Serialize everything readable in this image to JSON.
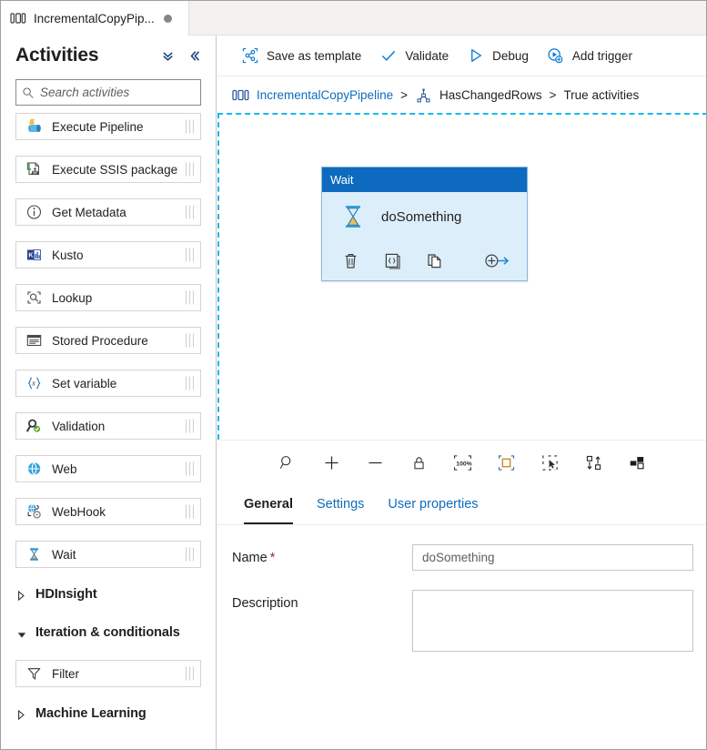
{
  "tab": {
    "icon": "pipeline-icon",
    "title": "IncrementalCopyPip...",
    "dirty_dot": "unsaved-changes-dot"
  },
  "sidebar": {
    "title": "Activities",
    "collapse_all_icon": "chevron-double-down-icon",
    "collapse_panel_icon": "chevron-double-left-icon",
    "search": {
      "placeholder": "Search activities",
      "value": "",
      "icon": "search-icon"
    },
    "items": [
      {
        "type": "activity",
        "label": "Execute Pipeline",
        "icon": "execute-pipeline-icon"
      },
      {
        "type": "activity",
        "label": "Execute SSIS package",
        "icon": "execute-ssis-package-icon"
      },
      {
        "type": "activity",
        "label": "Get Metadata",
        "icon": "get-metadata-icon"
      },
      {
        "type": "activity",
        "label": "Kusto",
        "icon": "kusto-icon"
      },
      {
        "type": "activity",
        "label": "Lookup",
        "icon": "lookup-icon"
      },
      {
        "type": "activity",
        "label": "Stored Procedure",
        "icon": "stored-procedure-icon"
      },
      {
        "type": "activity",
        "label": "Set variable",
        "icon": "set-variable-icon"
      },
      {
        "type": "activity",
        "label": "Validation",
        "icon": "validation-icon"
      },
      {
        "type": "activity",
        "label": "Web",
        "icon": "web-icon"
      },
      {
        "type": "activity",
        "label": "WebHook",
        "icon": "webhook-icon"
      },
      {
        "type": "activity",
        "label": "Wait",
        "icon": "wait-hourglass-icon"
      },
      {
        "type": "group",
        "label": "HDInsight",
        "expanded": false
      },
      {
        "type": "group",
        "label": "Iteration & conditionals",
        "expanded": true
      },
      {
        "type": "activity",
        "label": "Filter",
        "icon": "filter-funnel-icon"
      },
      {
        "type": "group",
        "label": "Machine Learning",
        "expanded": false
      }
    ]
  },
  "commandbar": {
    "buttons": [
      {
        "label": "Save as template",
        "icon": "save-as-template-icon"
      },
      {
        "label": "Validate",
        "icon": "checkmark-icon"
      },
      {
        "label": "Debug",
        "icon": "play-triangle-icon"
      },
      {
        "label": "Add trigger",
        "icon": "add-trigger-icon"
      }
    ]
  },
  "breadcrumb": {
    "icon": "pipeline-icon",
    "pipeline": "IncrementalCopyPipeline",
    "sep1": ">",
    "activity_icon": "if-condition-icon",
    "activity": "HasChangedRows",
    "sep2": ">",
    "branch": "True activities"
  },
  "canvas": {
    "node": {
      "type_label": "Wait",
      "name": "doSomething",
      "type_icon": "wait-hourglass-icon",
      "actions": [
        {
          "name": "delete-activity-icon"
        },
        {
          "name": "view-code-icon"
        },
        {
          "name": "clone-activity-icon"
        },
        {
          "name": "add-output-connection-icon"
        }
      ],
      "output_handle": "success-output-handle"
    }
  },
  "zoombar": {
    "tools": [
      {
        "name": "zoom-to-fit-icon"
      },
      {
        "name": "zoom-in-icon"
      },
      {
        "name": "zoom-out-icon"
      },
      {
        "name": "lock-canvas-icon"
      },
      {
        "name": "zoom-100-percent-icon",
        "label": "100%"
      },
      {
        "name": "fit-to-screen-icon"
      },
      {
        "name": "select-mode-icon"
      },
      {
        "name": "auto-align-icon"
      },
      {
        "name": "toggle-minimap-icon"
      }
    ]
  },
  "properties": {
    "tabs": [
      {
        "label": "General",
        "active": true
      },
      {
        "label": "Settings",
        "active": false
      },
      {
        "label": "User properties",
        "active": false
      }
    ],
    "fields": {
      "name": {
        "label": "Name",
        "required_marker": "*",
        "value": "doSomething",
        "placeholder": ""
      },
      "description": {
        "label": "Description",
        "value": "",
        "placeholder": ""
      }
    }
  },
  "colors": {
    "accent": "#0078d4",
    "link": "#0f6cbd",
    "node_header": "#0d6abf",
    "node_body": "#ddeefb",
    "canvas_dash": "#1bb7ea",
    "success_handle": "#4b8b4b",
    "required_red": "#a4262c"
  }
}
